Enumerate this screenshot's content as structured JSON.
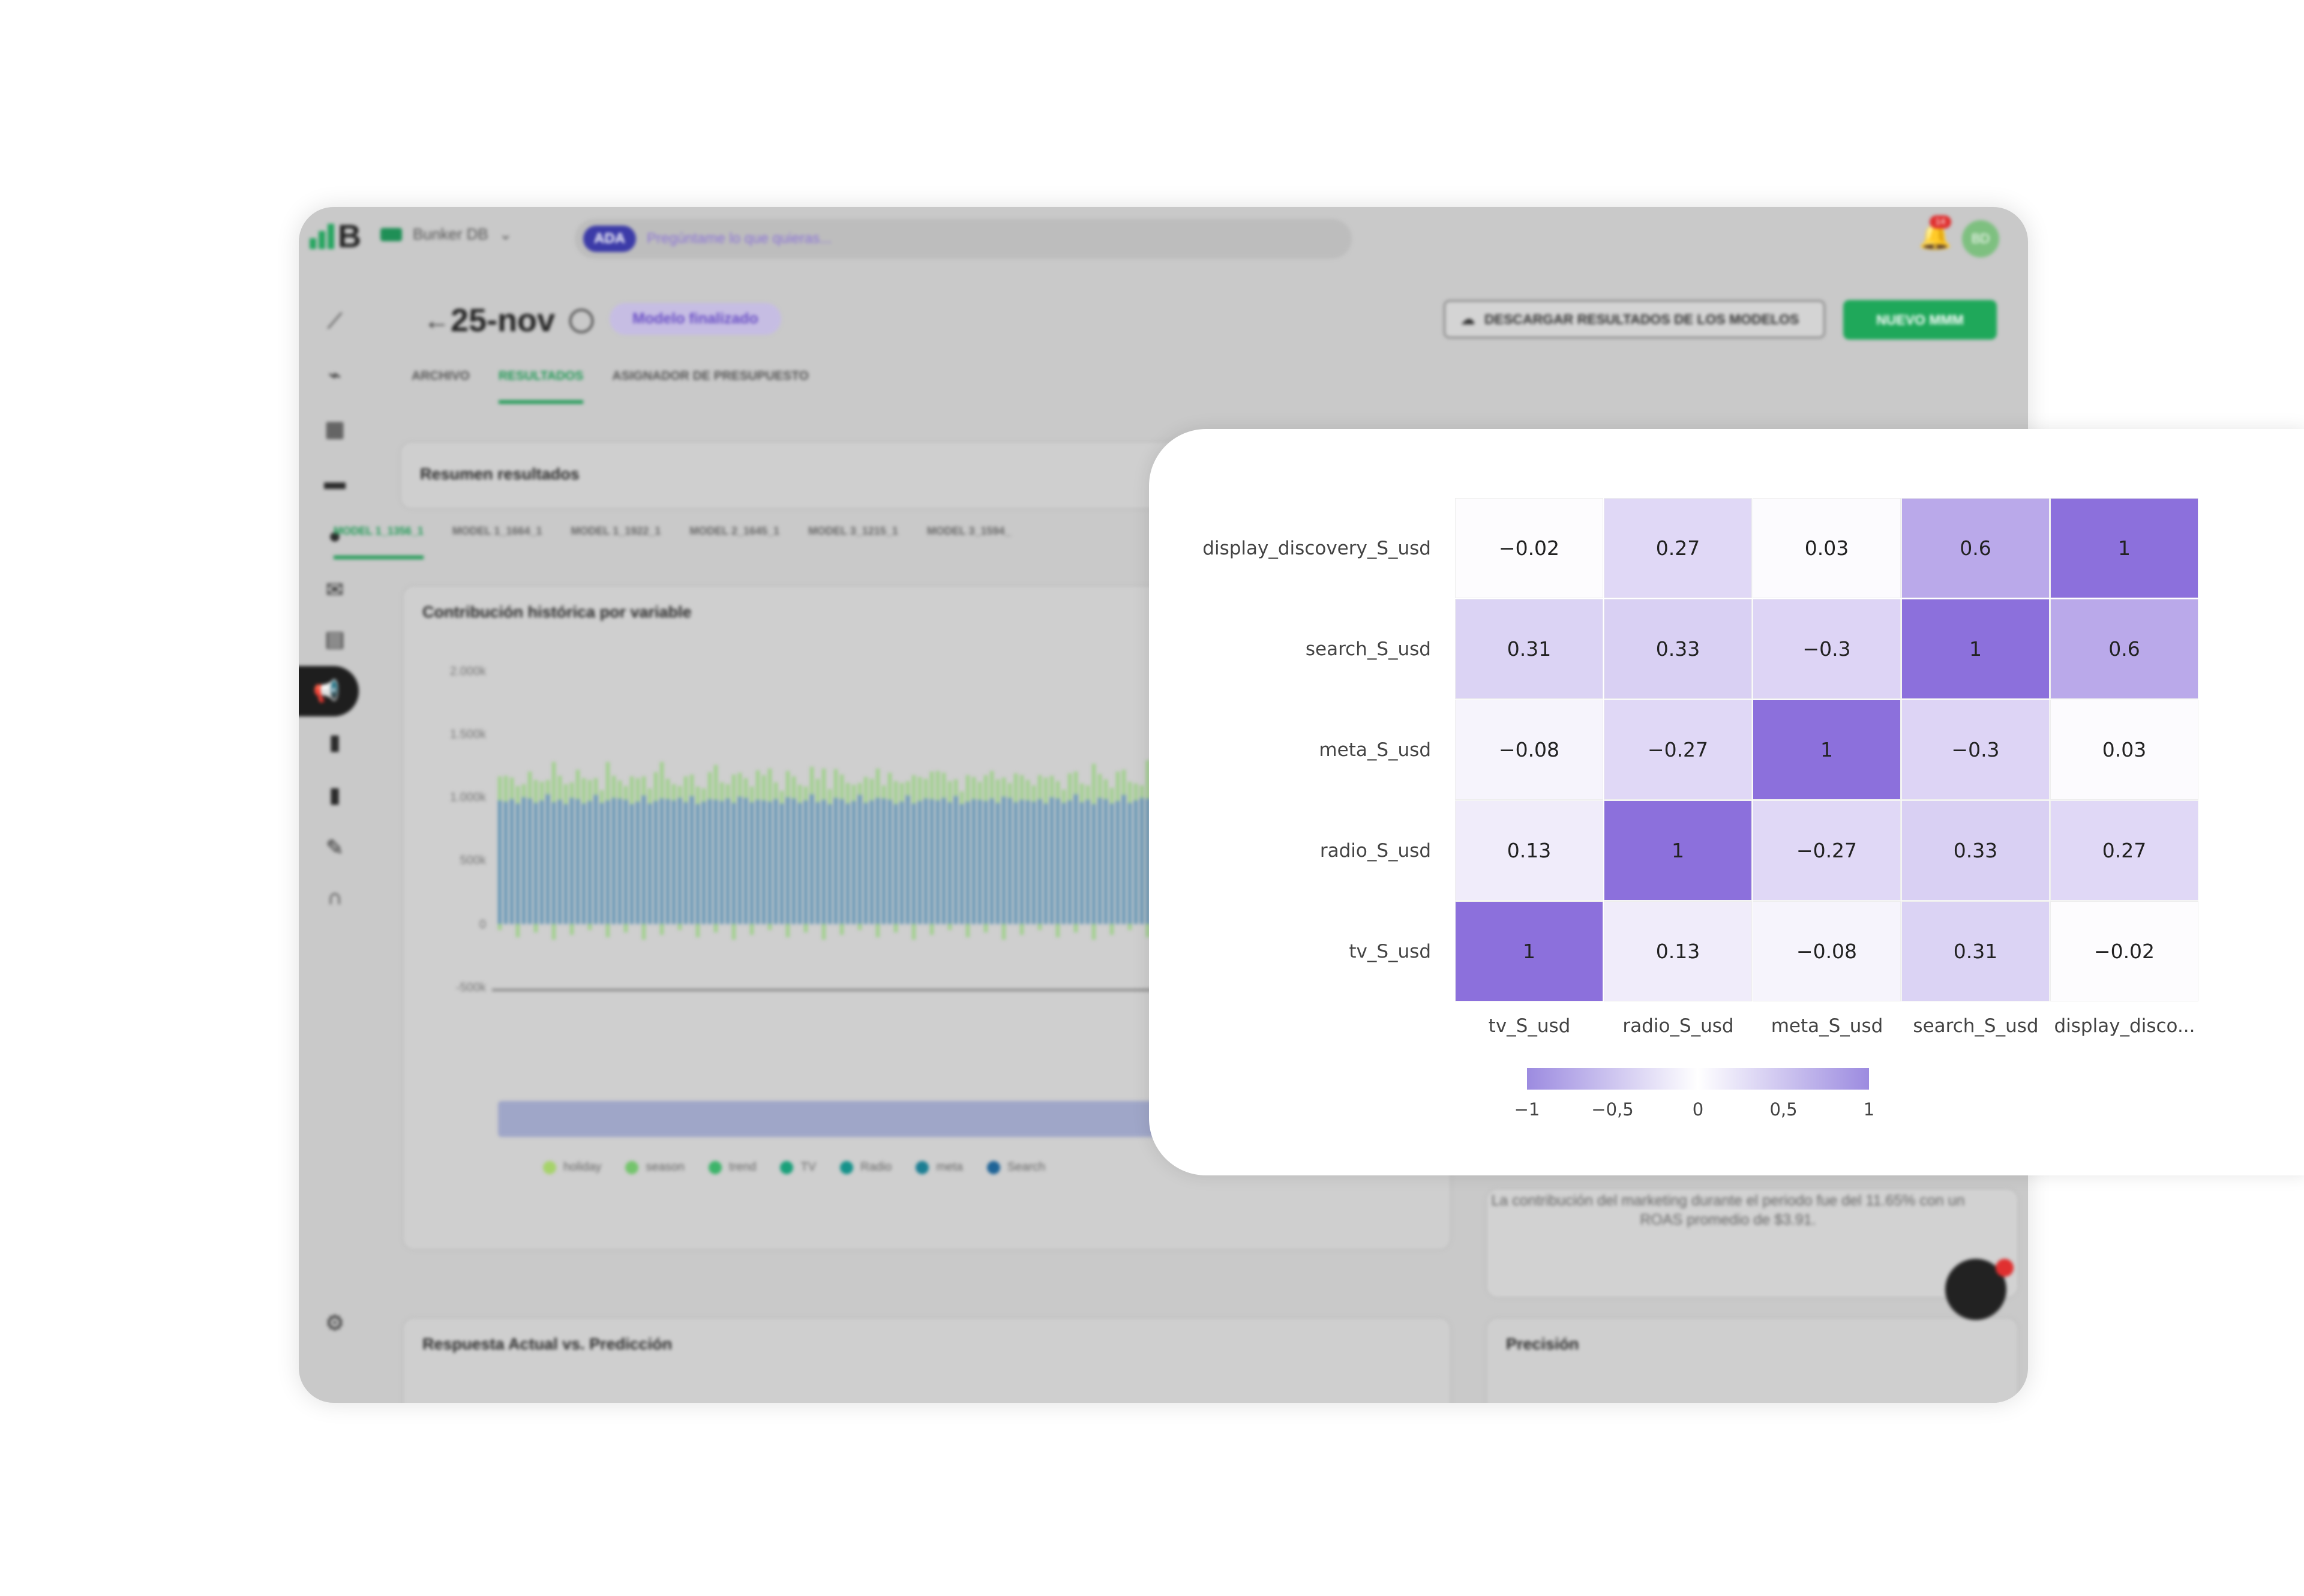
{
  "topbar": {
    "workspace": "Bunker DB",
    "ada_label": "ADA",
    "search_placeholder": "Pregúntame lo que quieras...",
    "notif_count": "14",
    "avatar_initials": "BD"
  },
  "page": {
    "title": "25-nov",
    "status": "Modelo finalizado",
    "download_btn": "DESCARGAR RESULTADOS DE LOS MODELOS",
    "new_btn": "NUEVO MMM"
  },
  "tabs": [
    "ARCHIVO",
    "RESULTADOS",
    "ASIGNADOR DE PRESUPUESTO"
  ],
  "summary_title": "Resumen resultados",
  "model_tabs": [
    "MODEL 1_1356_1",
    "MODEL 1_1664_1",
    "MODEL 1_1922_1",
    "MODEL 2_1645_1",
    "MODEL 3_1215_1",
    "MODEL 3_1594_"
  ],
  "history_card": {
    "title": "Contribución histórica por variable",
    "yticks": [
      "2.000k",
      "1.500k",
      "1.000k",
      "500k",
      "0",
      "-500k"
    ],
    "legend": [
      "holiday",
      "season",
      "trend",
      "TV",
      "Radio",
      "meta",
      "Search"
    ]
  },
  "note_text": "La contribución del marketing durante el periodo fue del 11.65% con un ROAS promedio de $3.91.",
  "bottom_cards": {
    "left": "Respuesta Actual vs. Predicción",
    "right": "Precisión"
  },
  "colors": {
    "accent_green": "#1fa85a",
    "heat_max": "#8c70dc"
  },
  "chart_data": {
    "type": "heatmap",
    "rows": [
      "display_discovery_S_usd",
      "search_S_usd",
      "meta_S_usd",
      "radio_S_usd",
      "tv_S_usd"
    ],
    "columns": [
      "tv_S_usd",
      "radio_S_usd",
      "meta_S_usd",
      "search_S_usd",
      "display_disco..."
    ],
    "values": [
      [
        -0.02,
        0.27,
        0.03,
        0.6,
        1
      ],
      [
        0.31,
        0.33,
        -0.3,
        1,
        0.6
      ],
      [
        -0.08,
        -0.27,
        1,
        -0.3,
        0.03
      ],
      [
        0.13,
        1,
        -0.27,
        0.33,
        0.27
      ],
      [
        1,
        0.13,
        -0.08,
        0.31,
        -0.02
      ]
    ],
    "labels": [
      [
        "−0.02",
        "0.27",
        "0.03",
        "0.6",
        "1"
      ],
      [
        "0.31",
        "0.33",
        "−0.3",
        "1",
        "0.6"
      ],
      [
        "−0.08",
        "−0.27",
        "1",
        "−0.3",
        "0.03"
      ],
      [
        "0.13",
        "1",
        "−0.27",
        "0.33",
        "0.27"
      ],
      [
        "1",
        "0.13",
        "−0.08",
        "0.31",
        "−0.02"
      ]
    ],
    "colorbar_ticks": [
      "−1",
      "−0,5",
      "0",
      "0,5",
      "1"
    ],
    "range": [
      -1,
      1
    ]
  }
}
